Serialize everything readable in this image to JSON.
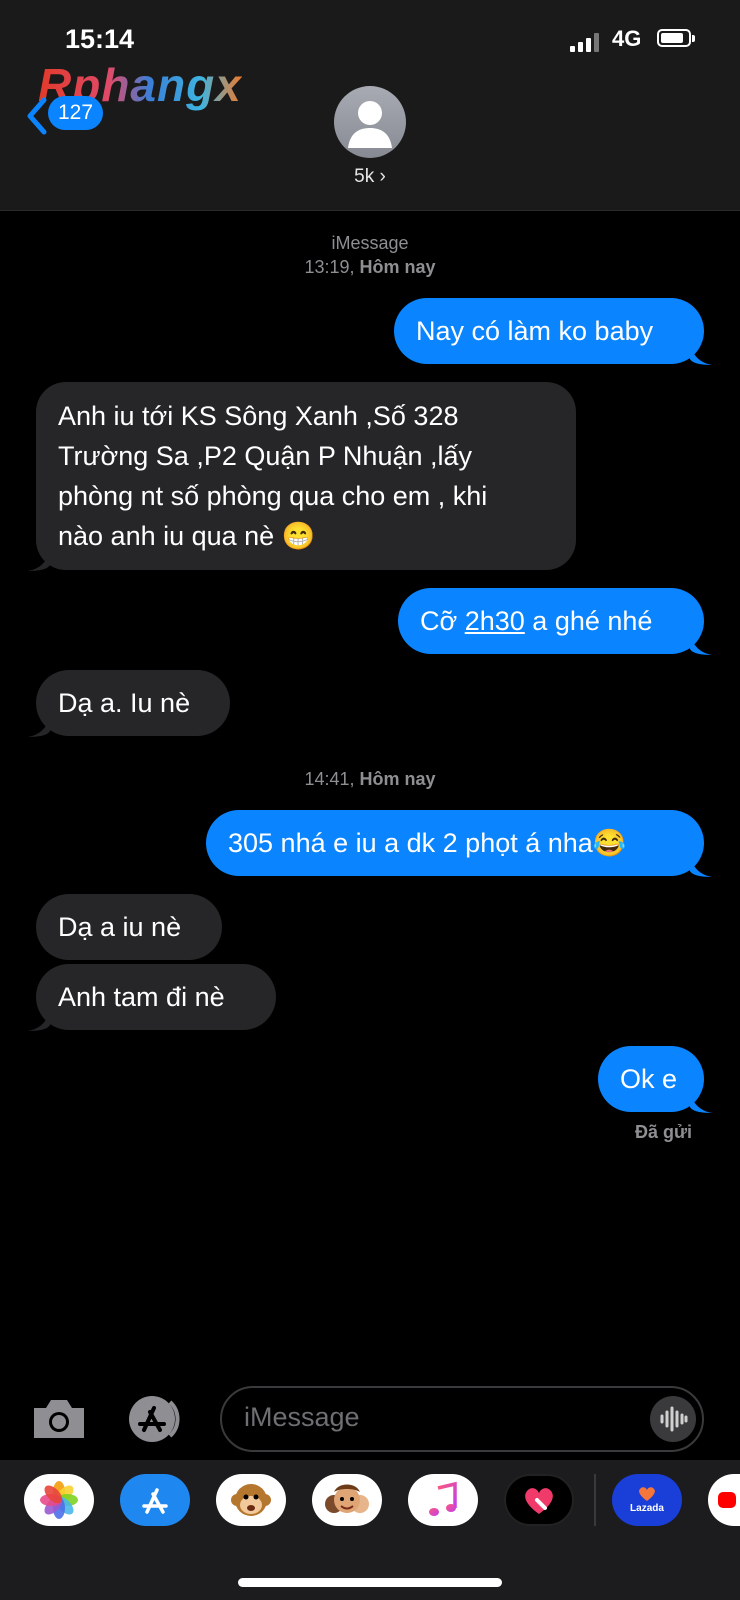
{
  "status": {
    "time": "15:14",
    "network": "4G"
  },
  "watermark": "Rphangx",
  "nav": {
    "back_count": "127",
    "contact_name": "5k ›"
  },
  "thread": {
    "service": "iMessage",
    "ts1": {
      "time": "13:19,",
      "day": "Hôm nay"
    },
    "ts2": {
      "time": "14:41,",
      "day": "Hôm nay"
    },
    "messages": [
      {
        "dir": "out",
        "text": "Nay có làm ko baby"
      },
      {
        "dir": "in",
        "lines": [
          "Anh iu tới KS Sông Xanh ,Số 328",
          "Trường Sa ,P2 Quận P Nhuận  ,lấy",
          "phòng nt số phòng qua cho em , khi",
          "nào anh iu qua nè 😁"
        ]
      },
      {
        "dir": "out",
        "pre": "Cỡ ",
        "link": "2h30",
        "post": " a ghé nhé"
      },
      {
        "dir": "in",
        "text": "Dạ a. Iu nè"
      },
      {
        "dir": "out",
        "text": "305 nhá e iu a dk 2 phọt á nha😂"
      },
      {
        "dir": "in",
        "text": "Dạ a iu nè"
      },
      {
        "dir": "in",
        "text": "Anh tam đi nè"
      },
      {
        "dir": "out",
        "text": "Ok e"
      }
    ],
    "delivered": "Đã gửi"
  },
  "composer": {
    "placeholder": "iMessage"
  },
  "drawer": {
    "apps": [
      "photos-icon",
      "app-store-icon",
      "monkey-memoji-icon",
      "memoji-icon",
      "music-icon",
      "digital-touch-icon",
      "lazada-icon",
      "youtube-icon"
    ],
    "lazada_label": "Lazada"
  },
  "colors": {
    "outgoing": "#0a84ff",
    "incoming": "#262629",
    "background": "#000000"
  }
}
